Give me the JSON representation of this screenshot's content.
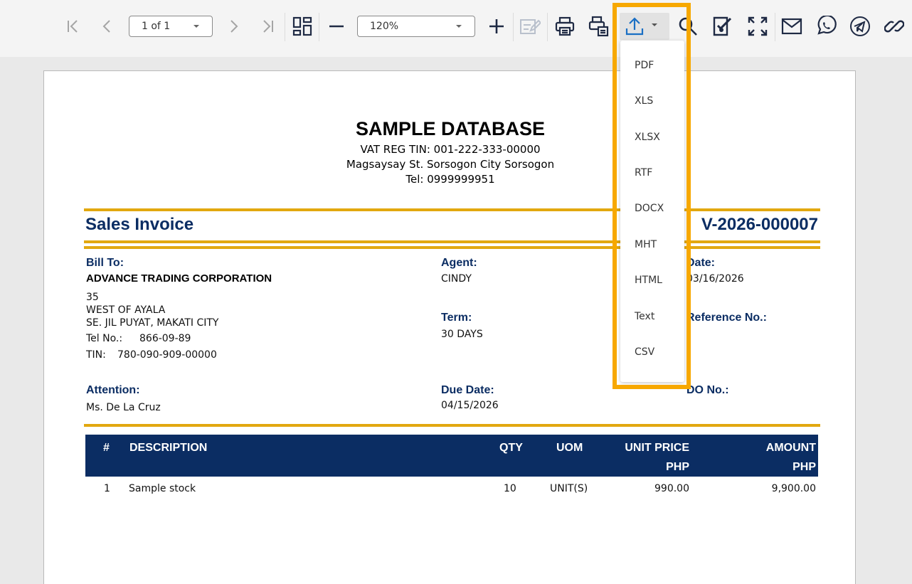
{
  "toolbar": {
    "page_indicator": "1 of 1",
    "zoom_level": "120%",
    "icons": [
      "first-page-icon",
      "previous-page-icon",
      "next-page-icon",
      "last-page-icon",
      "multi-page-icon",
      "zoom-out-icon",
      "zoom-in-icon",
      "edit-icon",
      "print-icon",
      "print-page-icon",
      "export-icon",
      "search-icon",
      "sign-icon",
      "fullscreen-icon",
      "email-icon",
      "whatsapp-icon",
      "telegram-icon",
      "link-icon"
    ],
    "accent_color": "#1a6fc4"
  },
  "export_menu": {
    "items": [
      "PDF",
      "XLS",
      "XLSX",
      "RTF",
      "DOCX",
      "MHT",
      "HTML",
      "Text",
      "CSV"
    ],
    "highlight_color": "#f7a800"
  },
  "document": {
    "company_name": "SAMPLE DATABASE",
    "vat_reg": "VAT REG TIN: 001-222-333-00000",
    "address": "Magsaysay St. Sorsogon City Sorsogon",
    "tel": "Tel: 0999999951",
    "doc_type": "Sales Invoice",
    "doc_number": "V-2026-000007",
    "bill_to_label": "Bill To:",
    "bill_to_name": "ADVANCE TRADING CORPORATION",
    "bill_to_line1": "35",
    "bill_to_line2": "WEST OF AYALA",
    "bill_to_line3": "SE. JIL PUYAT, MAKATI CITY",
    "tel_no_label": "Tel No.:",
    "tel_no_value": "866-09-89",
    "tin_label": "TIN:",
    "tin_value": "780-090-909-00000",
    "agent_label": "Agent:",
    "agent_value": "CINDY",
    "term_label": "Term:",
    "term_value": "30 DAYS",
    "date_label": "Date:",
    "date_value": "03/16/2026",
    "reference_label": "Reference No.:",
    "attention_label": "Attention:",
    "attention_value": "Ms. De La Cruz",
    "due_date_label": "Due Date:",
    "due_date_value": "04/15/2026",
    "do_label": "DO No.:",
    "brand_color": "#0b2d63",
    "rule_color": "#e2a80f"
  },
  "table": {
    "headers": {
      "num": "#",
      "description": "DESCRIPTION",
      "qty": "QTY",
      "uom": "UOM",
      "unit_price": "UNIT PRICE",
      "unit_price_currency": "PHP",
      "amount": "AMOUNT",
      "amount_currency": "PHP"
    },
    "rows": [
      {
        "num": "1",
        "description": "Sample stock",
        "qty": "10",
        "uom": "UNIT(S)",
        "unit_price": "990.00",
        "amount": "9,900.00"
      }
    ]
  }
}
